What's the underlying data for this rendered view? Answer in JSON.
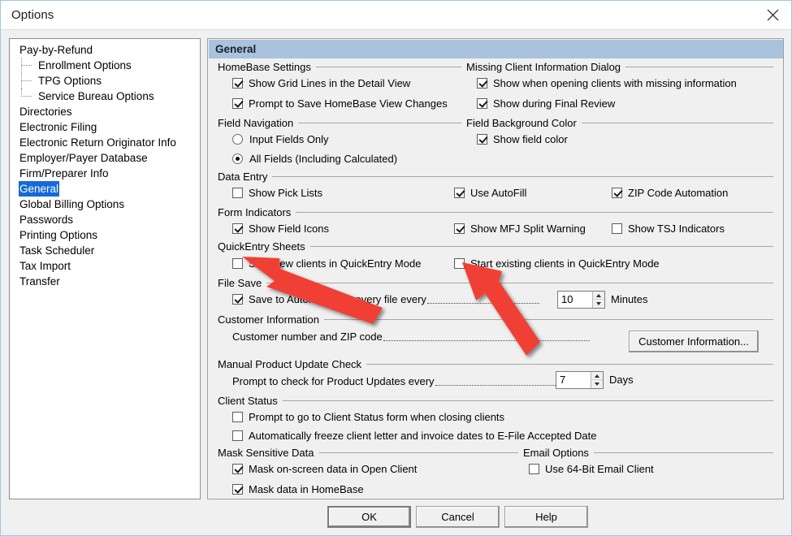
{
  "window": {
    "title": "Options",
    "close_icon": "close-icon"
  },
  "sidebar": {
    "items": [
      {
        "label": "Pay-by-Refund",
        "level": 0,
        "selected": false
      },
      {
        "label": "Enrollment Options",
        "level": 1,
        "selected": false
      },
      {
        "label": "TPG Options",
        "level": 1,
        "selected": false
      },
      {
        "label": "Service Bureau Options",
        "level": 1,
        "selected": false
      },
      {
        "label": "Directories",
        "level": 0,
        "selected": false
      },
      {
        "label": "Electronic Filing",
        "level": 0,
        "selected": false
      },
      {
        "label": "Electronic Return Originator Info",
        "level": 0,
        "selected": false
      },
      {
        "label": "Employer/Payer Database",
        "level": 0,
        "selected": false
      },
      {
        "label": "Firm/Preparer Info",
        "level": 0,
        "selected": false
      },
      {
        "label": "General",
        "level": 0,
        "selected": true
      },
      {
        "label": "Global Billing Options",
        "level": 0,
        "selected": false
      },
      {
        "label": "Passwords",
        "level": 0,
        "selected": false
      },
      {
        "label": "Printing Options",
        "level": 0,
        "selected": false
      },
      {
        "label": "Task Scheduler",
        "level": 0,
        "selected": false
      },
      {
        "label": "Tax Import",
        "level": 0,
        "selected": false
      },
      {
        "label": "Transfer",
        "level": 0,
        "selected": false
      }
    ]
  },
  "panel": {
    "header": "General",
    "groups": {
      "homebase_settings": "HomeBase Settings",
      "missing_client_info": "Missing Client Information Dialog",
      "field_navigation": "Field Navigation",
      "field_background_color": "Field Background Color",
      "data_entry": "Data Entry",
      "form_indicators": "Form Indicators",
      "quickentry_sheets": "QuickEntry Sheets",
      "file_save": "File Save",
      "customer_information": "Customer Information",
      "manual_product_update": "Manual Product Update Check",
      "client_status": "Client Status",
      "mask_sensitive_data": "Mask Sensitive Data",
      "email_options": "Email Options"
    },
    "checkboxes": {
      "show_grid_lines": {
        "label": "Show Grid Lines in the Detail View",
        "checked": true
      },
      "prompt_save_homebase": {
        "label": "Prompt to Save HomeBase View Changes",
        "checked": true
      },
      "show_when_opening": {
        "label": "Show when opening clients with missing information",
        "checked": true
      },
      "show_final_review": {
        "label": "Show during Final Review",
        "checked": true
      },
      "show_field_color": {
        "label": "Show field color",
        "checked": true
      },
      "show_pick_lists": {
        "label": "Show Pick Lists",
        "checked": false
      },
      "use_autofill": {
        "label": "Use AutoFill",
        "checked": true
      },
      "zip_code_automation": {
        "label": "ZIP Code Automation",
        "checked": true
      },
      "show_field_icons": {
        "label": "Show Field Icons",
        "checked": true
      },
      "show_mfj_split": {
        "label": "Show MFJ Split Warning",
        "checked": true
      },
      "show_tsj_indicators": {
        "label": "Show TSJ Indicators",
        "checked": false
      },
      "start_new_quickentry": {
        "label": "Start new clients in QuickEntry Mode",
        "checked": false
      },
      "start_existing_quickentry": {
        "label": "Start existing clients in QuickEntry Mode",
        "checked": false
      },
      "save_auto_recovery": {
        "label": "Save to Automatic Recovery file every",
        "checked": true
      },
      "prompt_client_status": {
        "label": "Prompt to go to Client Status form when closing clients",
        "checked": false
      },
      "auto_freeze": {
        "label": "Automatically freeze client letter and invoice dates to E-File Accepted Date",
        "checked": false
      },
      "mask_open_client": {
        "label": "Mask on-screen data in Open Client",
        "checked": true
      },
      "mask_homebase": {
        "label": "Mask data in HomeBase",
        "checked": true
      },
      "use_64bit_email": {
        "label": "Use 64-Bit Email Client",
        "checked": false
      }
    },
    "radios": {
      "input_fields_only": {
        "label": "Input Fields Only",
        "selected": false
      },
      "all_fields": {
        "label": "All Fields (Including Calculated)",
        "selected": true
      }
    },
    "fields": {
      "auto_recovery_minutes": {
        "value": "10",
        "unit": "Minutes"
      },
      "product_update_days": {
        "value": "7",
        "unit": "Days"
      }
    },
    "labels": {
      "customer_number_zip": "Customer number and ZIP code",
      "prompt_product_updates": "Prompt to check for Product Updates every"
    },
    "buttons": {
      "customer_information": "Customer Information..."
    }
  },
  "footer": {
    "ok": "OK",
    "cancel": "Cancel",
    "help": "Help"
  },
  "annotations": {
    "arrow_color": "#f03f34",
    "arrow_1": "arrow-pointing-to-start-new-clients-checkbox",
    "arrow_2": "arrow-pointing-to-start-existing-clients-checkbox"
  }
}
